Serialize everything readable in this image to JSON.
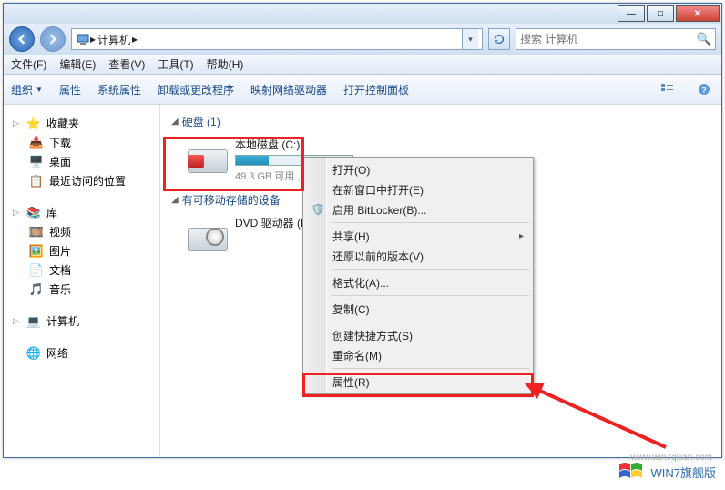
{
  "window": {
    "breadcrumb_label": "计算机",
    "breadcrumb_arrow": "▸",
    "search_placeholder": "搜索 计算机"
  },
  "menubar": {
    "file": "文件(F)",
    "edit": "编辑(E)",
    "view": "查看(V)",
    "tools": "工具(T)",
    "help": "帮助(H)"
  },
  "toolbar": {
    "organize": "组织",
    "properties": "属性",
    "sysprops": "系统属性",
    "uninstall": "卸载或更改程序",
    "mapdrive": "映射网络驱动器",
    "control": "打开控制面板"
  },
  "sidebar": {
    "favorites": {
      "label": "收藏夹",
      "items": [
        "下载",
        "桌面",
        "最近访问的位置"
      ]
    },
    "libraries": {
      "label": "库",
      "items": [
        "视频",
        "图片",
        "文档",
        "音乐"
      ]
    },
    "computer": {
      "label": "计算机"
    },
    "network": {
      "label": "网络"
    }
  },
  "content": {
    "hdd_header": "硬盘 (1)",
    "removable_header": "有可移动存储的设备",
    "drive_c": {
      "name": "本地磁盘 (C:)",
      "subtitle": "49.3 GB 可用 ,"
    },
    "dvd": {
      "name": "DVD 驱动器 (D"
    }
  },
  "context_menu": {
    "open": "打开(O)",
    "open_new": "在新窗口中打开(E)",
    "bitlocker": "启用 BitLocker(B)...",
    "share": "共享(H)",
    "restore": "还原以前的版本(V)",
    "format": "格式化(A)...",
    "copy": "复制(C)",
    "shortcut": "创建快捷方式(S)",
    "rename": "重命名(M)",
    "properties": "属性(R)"
  },
  "watermark": {
    "text": "WIN7旗舰版",
    "url": "www.win7qijian.com"
  }
}
